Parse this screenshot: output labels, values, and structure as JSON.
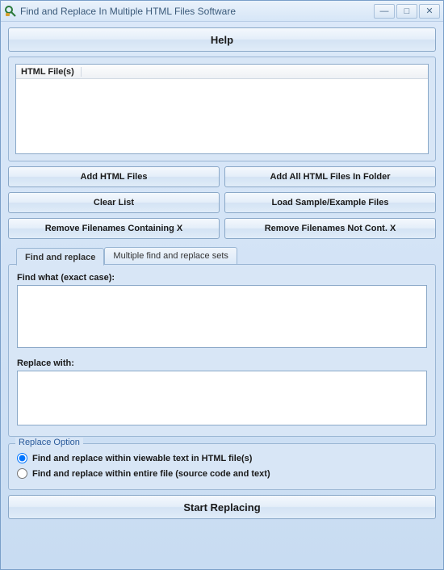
{
  "window": {
    "title": "Find and Replace In Multiple HTML Files Software"
  },
  "help_button": "Help",
  "file_list": {
    "header": "HTML File(s)"
  },
  "buttons": {
    "add_files": "Add HTML Files",
    "add_folder": "Add All HTML Files In Folder",
    "clear_list": "Clear List",
    "load_sample": "Load Sample/Example Files",
    "remove_containing": "Remove Filenames Containing X",
    "remove_not_containing": "Remove Filenames Not Cont. X"
  },
  "tabs": {
    "find_replace": "Find and replace",
    "multiple_sets": "Multiple find and replace sets"
  },
  "fields": {
    "find_what_label": "Find what (exact case):",
    "find_what_value": "",
    "replace_with_label": "Replace with:",
    "replace_with_value": ""
  },
  "replace_option": {
    "legend": "Replace Option",
    "opt_viewable": "Find and replace within viewable text in HTML file(s)",
    "opt_entire": "Find and replace within entire file (source code and text)",
    "selected": "viewable"
  },
  "start_button": "Start Replacing"
}
